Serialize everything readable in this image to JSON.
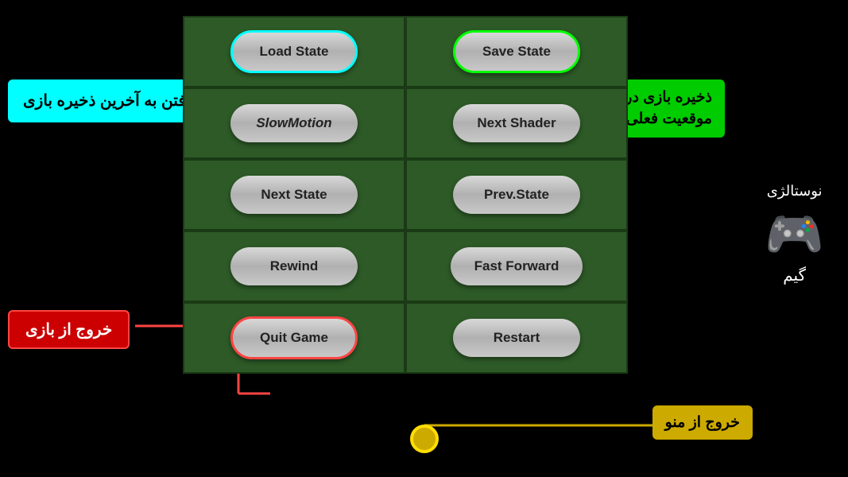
{
  "buttons": {
    "load_state": "Load State",
    "save_state": "Save State",
    "slow_motion": "SlowMotion",
    "next_shader": "Next Shader",
    "next_state": "Next State",
    "prev_state": "Prev.State",
    "rewind": "Rewind",
    "fast_forward": "Fast Forward",
    "quit_game": "Quit Game",
    "restart": "Restart"
  },
  "labels": {
    "cyan": "رفتن به آخرین\nذخیره بازی",
    "green_line1": "ذخیره بازی در",
    "green_line2": "موقعیت فعلی",
    "red": "خروج از بازی",
    "yellow": "خروج از منو"
  },
  "logo": {
    "title": "نوستالژی",
    "subtitle": "گیم"
  },
  "colors": {
    "cyan": "#00ffff",
    "green": "#00cc00",
    "red": "#cc0000",
    "yellow": "#ccaa00",
    "bg_cell": "#2d5a27"
  }
}
